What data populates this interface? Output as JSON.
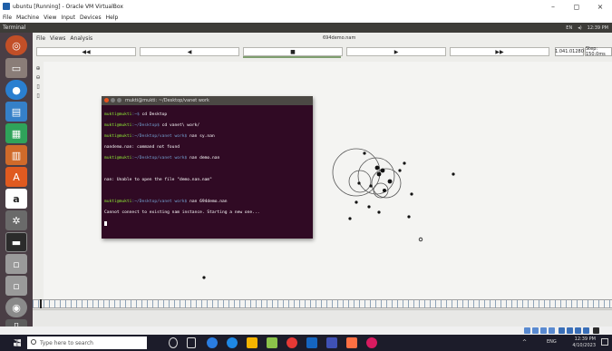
{
  "window": {
    "title": "ubuntu [Running] - Oracle VM VirtualBox",
    "controls": [
      "–",
      "◻",
      "×"
    ],
    "menu": [
      "File",
      "Machine",
      "View",
      "Input",
      "Devices",
      "Help"
    ]
  },
  "ubuntu_panel": {
    "app_name": "Terminal",
    "status": [
      "EN",
      "12:39 PM"
    ]
  },
  "nam": {
    "menu": [
      "File",
      "Views",
      "Analysis"
    ],
    "file_title": "694demo.nam",
    "toolbar": {
      "rewind_label": "◀◀",
      "back_label": "◀",
      "stop_label": "■",
      "play_label": "▶",
      "ffwd_label": "▶▶",
      "time_value": "1.041.01280",
      "step_value": "Step: 150.0ms"
    },
    "side_buttons": [
      "⊕",
      "⊖",
      "▯",
      "▯"
    ]
  },
  "terminal": {
    "title": "mukti@mukti: ~/Desktop/vanet work",
    "lines": [
      {
        "prompt": "mukti@mukti",
        "path": ":~$",
        "cmd": " cd Desktop"
      },
      {
        "prompt": "mukti@mukti",
        "path": ":~/Desktop$",
        "cmd": " cd vanet\\ work/"
      },
      {
        "prompt": "mukti@mukti",
        "path": ":~/Desktop/vanet work$",
        "cmd": " nan sy.nan"
      },
      {
        "prompt": "",
        "path": "",
        "cmd": "nandemo.nan: command not found"
      },
      {
        "prompt": "mukti@mukti",
        "path": ":~/Desktop/vanet work$",
        "cmd": " nan demo.nan"
      },
      {
        "prompt": "",
        "path": "",
        "cmd": ""
      },
      {
        "prompt": "",
        "path": "",
        "cmd": "nan: Unable to open the file \"demo.nan.nam\""
      },
      {
        "prompt": "",
        "path": "",
        "cmd": ""
      },
      {
        "prompt": "mukti@mukti",
        "path": ":~/Desktop/vanet work$",
        "cmd": " nan 694demo.nan"
      },
      {
        "prompt": "",
        "path": "",
        "cmd": "Cannot connect to existing nam instance. Starting a new one..."
      }
    ]
  },
  "taskbar": {
    "search_placeholder": "Type here to search",
    "clock_time": "12:39 PM",
    "clock_date": "4/10/2023",
    "lang": "ENG"
  },
  "colors": {
    "terminal_bg": "#300a24",
    "launcher_bg": "#4a3e45",
    "taskbar_bg": "#1c1c2a",
    "prompt_green": "#8ae234",
    "path_blue": "#729fcf"
  }
}
